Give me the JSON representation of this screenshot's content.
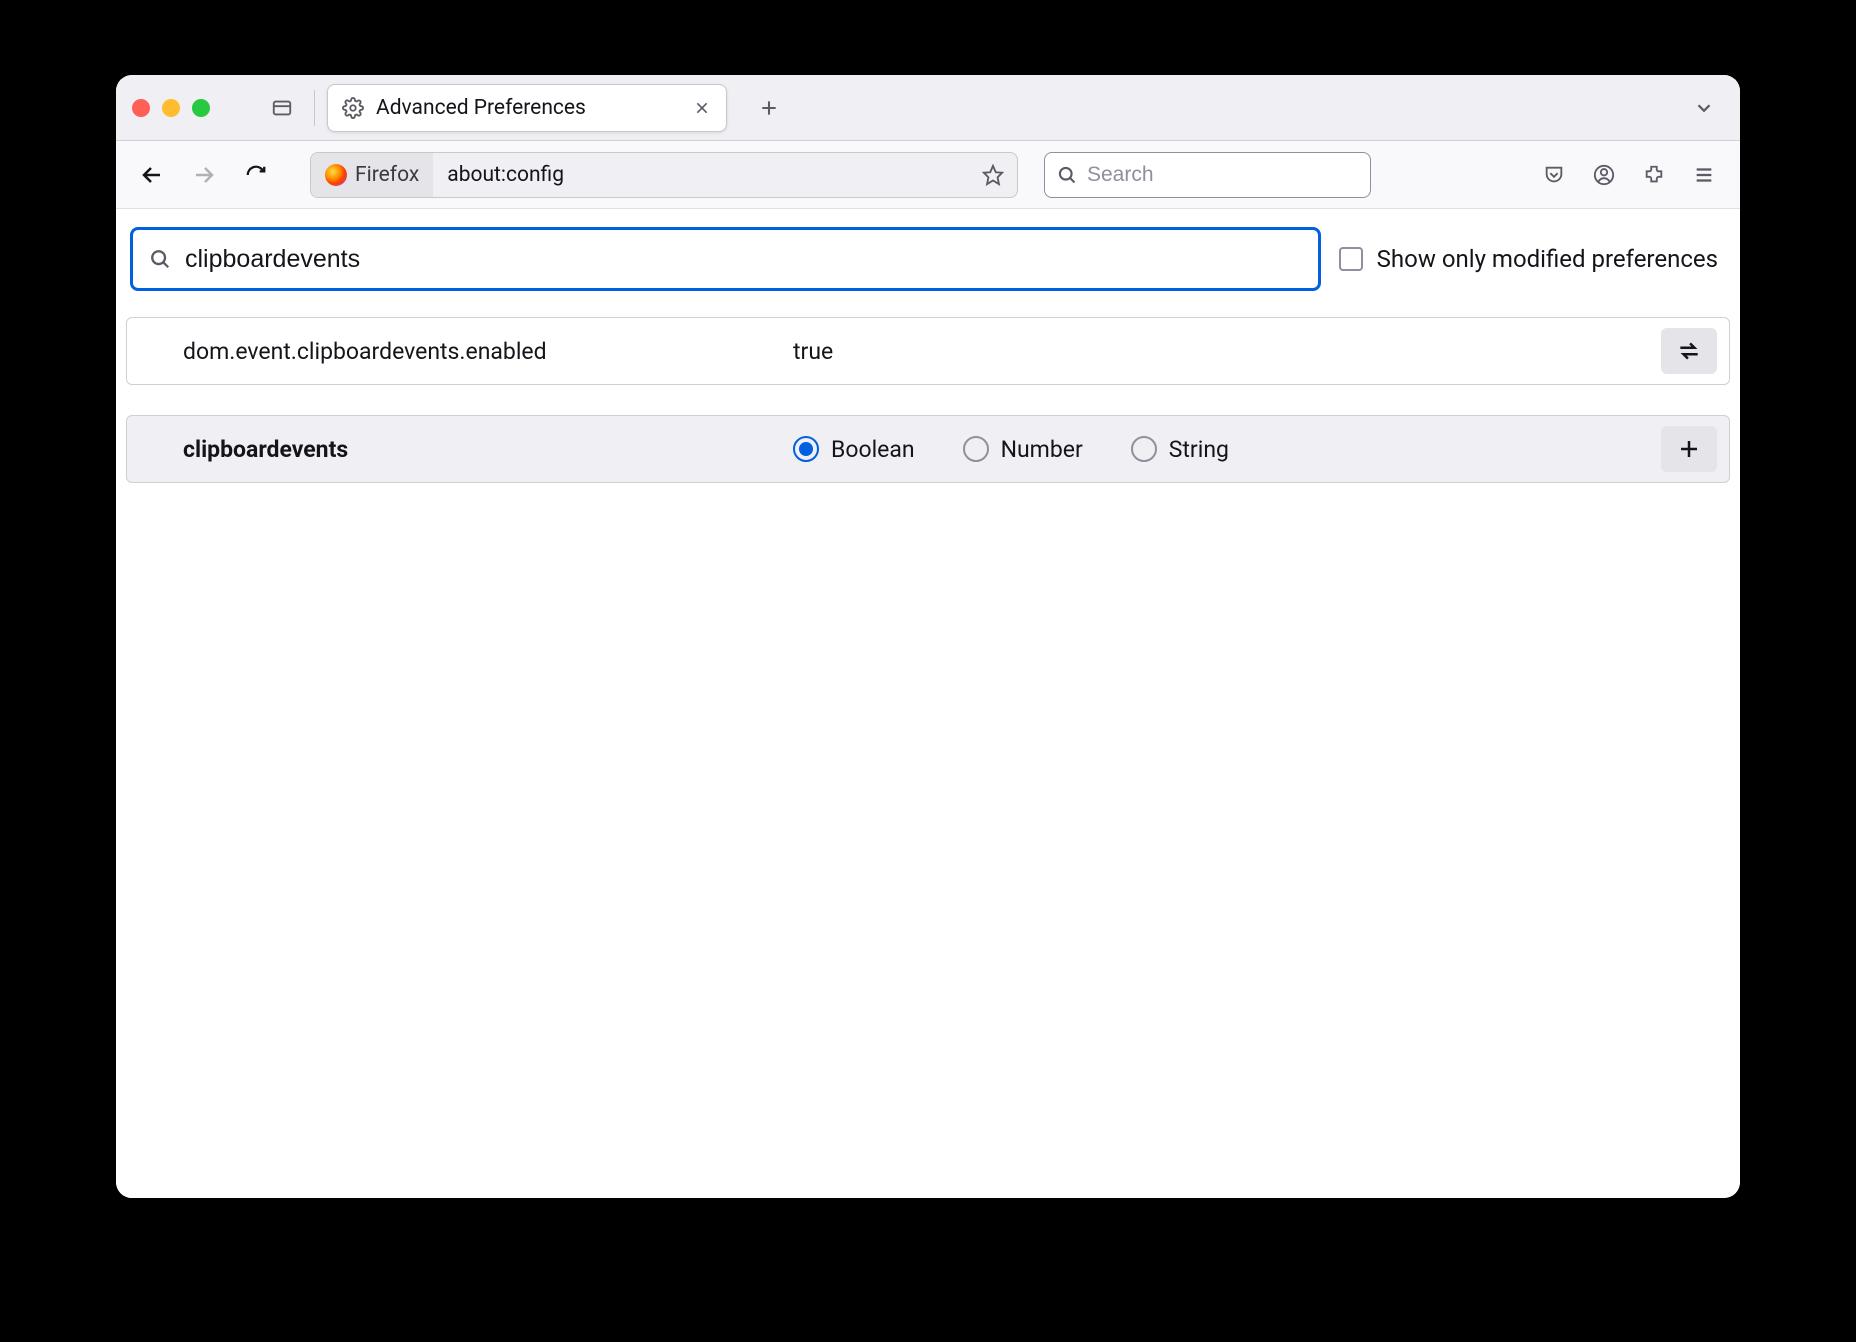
{
  "titlebar": {
    "tab_title": "Advanced Preferences"
  },
  "toolbar": {
    "identity_label": "Firefox",
    "url": "about:config",
    "search_placeholder": "Search"
  },
  "config": {
    "filter_value": "clipboardevents",
    "show_modified_label": "Show only modified preferences",
    "rows": [
      {
        "name": "dom.event.clipboardevents.enabled",
        "value": "true"
      }
    ],
    "new_pref_name": "clipboardevents",
    "type_options": {
      "boolean": "Boolean",
      "number": "Number",
      "string": "String"
    },
    "selected_type": "boolean"
  }
}
